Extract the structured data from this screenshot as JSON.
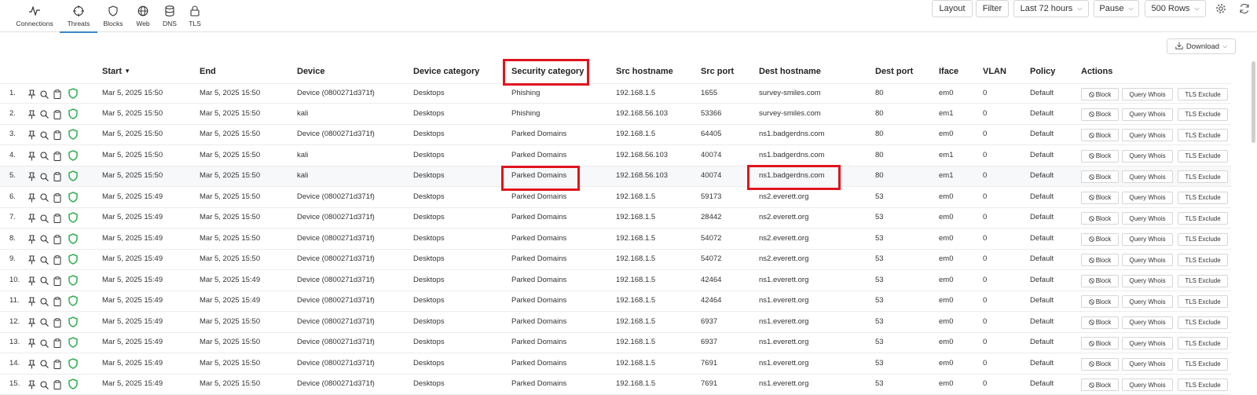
{
  "nav": [
    {
      "label": "Connections",
      "icon": "activity-icon"
    },
    {
      "label": "Threats",
      "icon": "crosshair-icon"
    },
    {
      "label": "Blocks",
      "icon": "shield-icon"
    },
    {
      "label": "Web",
      "icon": "globe-icon"
    },
    {
      "label": "DNS",
      "icon": "database-icon"
    },
    {
      "label": "TLS",
      "icon": "lock-icon"
    }
  ],
  "toolbar": {
    "layout": "Layout",
    "filter": "Filter",
    "timerange": "Last 72 hours",
    "pause": "Pause",
    "rows": "500 Rows",
    "download": "Download"
  },
  "columns": {
    "start": "Start",
    "end": "End",
    "device": "Device",
    "device_category": "Device category",
    "security_category": "Security category",
    "src_hostname": "Src hostname",
    "src_port": "Src port",
    "dest_hostname": "Dest hostname",
    "dest_port": "Dest port",
    "iface": "Iface",
    "vlan": "VLAN",
    "policy": "Policy",
    "actions": "Actions"
  },
  "actions": {
    "block": "Block",
    "whois": "Query Whois",
    "tls": "TLS Exclude"
  },
  "rows": [
    {
      "n": "1.",
      "start": "Mar 5, 2025 15:50",
      "end": "Mar 5, 2025 15:50",
      "device": "Device (0800271d371f)",
      "devcat": "Desktops",
      "seccat": "Phishing",
      "src": "192.168.1.5",
      "sport": "1655",
      "dest": "survey-smiles.com",
      "dport": "80",
      "iface": "em0",
      "vlan": "0",
      "policy": "Default"
    },
    {
      "n": "2.",
      "start": "Mar 5, 2025 15:50",
      "end": "Mar 5, 2025 15:50",
      "device": "kali",
      "devcat": "Desktops",
      "seccat": "Phishing",
      "src": "192.168.56.103",
      "sport": "53366",
      "dest": "survey-smiles.com",
      "dport": "80",
      "iface": "em1",
      "vlan": "0",
      "policy": "Default"
    },
    {
      "n": "3.",
      "start": "Mar 5, 2025 15:50",
      "end": "Mar 5, 2025 15:50",
      "device": "Device (0800271d371f)",
      "devcat": "Desktops",
      "seccat": "Parked Domains",
      "src": "192.168.1.5",
      "sport": "64405",
      "dest": "ns1.badgerdns.com",
      "dport": "80",
      "iface": "em0",
      "vlan": "0",
      "policy": "Default"
    },
    {
      "n": "4.",
      "start": "Mar 5, 2025 15:50",
      "end": "Mar 5, 2025 15:50",
      "device": "kali",
      "devcat": "Desktops",
      "seccat": "Parked Domains",
      "src": "192.168.56.103",
      "sport": "40074",
      "dest": "ns1.badgerdns.com",
      "dport": "80",
      "iface": "em1",
      "vlan": "0",
      "policy": "Default"
    },
    {
      "n": "5.",
      "start": "Mar 5, 2025 15:50",
      "end": "Mar 5, 2025 15:50",
      "device": "kali",
      "devcat": "Desktops",
      "seccat": "Parked Domains",
      "src": "192.168.56.103",
      "sport": "40074",
      "dest": "ns1.badgerdns.com",
      "dport": "80",
      "iface": "em1",
      "vlan": "0",
      "policy": "Default"
    },
    {
      "n": "6.",
      "start": "Mar 5, 2025 15:49",
      "end": "Mar 5, 2025 15:50",
      "device": "Device (0800271d371f)",
      "devcat": "Desktops",
      "seccat": "Parked Domains",
      "src": "192.168.1.5",
      "sport": "59173",
      "dest": "ns2.everett.org",
      "dport": "53",
      "iface": "em0",
      "vlan": "0",
      "policy": "Default"
    },
    {
      "n": "7.",
      "start": "Mar 5, 2025 15:49",
      "end": "Mar 5, 2025 15:50",
      "device": "Device (0800271d371f)",
      "devcat": "Desktops",
      "seccat": "Parked Domains",
      "src": "192.168.1.5",
      "sport": "28442",
      "dest": "ns2.everett.org",
      "dport": "53",
      "iface": "em0",
      "vlan": "0",
      "policy": "Default"
    },
    {
      "n": "8.",
      "start": "Mar 5, 2025 15:49",
      "end": "Mar 5, 2025 15:50",
      "device": "Device (0800271d371f)",
      "devcat": "Desktops",
      "seccat": "Parked Domains",
      "src": "192.168.1.5",
      "sport": "54072",
      "dest": "ns2.everett.org",
      "dport": "53",
      "iface": "em0",
      "vlan": "0",
      "policy": "Default"
    },
    {
      "n": "9.",
      "start": "Mar 5, 2025 15:49",
      "end": "Mar 5, 2025 15:50",
      "device": "Device (0800271d371f)",
      "devcat": "Desktops",
      "seccat": "Parked Domains",
      "src": "192.168.1.5",
      "sport": "54072",
      "dest": "ns2.everett.org",
      "dport": "53",
      "iface": "em0",
      "vlan": "0",
      "policy": "Default"
    },
    {
      "n": "10.",
      "start": "Mar 5, 2025 15:49",
      "end": "Mar 5, 2025 15:49",
      "device": "Device (0800271d371f)",
      "devcat": "Desktops",
      "seccat": "Parked Domains",
      "src": "192.168.1.5",
      "sport": "42464",
      "dest": "ns1.everett.org",
      "dport": "53",
      "iface": "em0",
      "vlan": "0",
      "policy": "Default"
    },
    {
      "n": "11.",
      "start": "Mar 5, 2025 15:49",
      "end": "Mar 5, 2025 15:49",
      "device": "Device (0800271d371f)",
      "devcat": "Desktops",
      "seccat": "Parked Domains",
      "src": "192.168.1.5",
      "sport": "42464",
      "dest": "ns1.everett.org",
      "dport": "53",
      "iface": "em0",
      "vlan": "0",
      "policy": "Default"
    },
    {
      "n": "12.",
      "start": "Mar 5, 2025 15:49",
      "end": "Mar 5, 2025 15:50",
      "device": "Device (0800271d371f)",
      "devcat": "Desktops",
      "seccat": "Parked Domains",
      "src": "192.168.1.5",
      "sport": "6937",
      "dest": "ns1.everett.org",
      "dport": "53",
      "iface": "em0",
      "vlan": "0",
      "policy": "Default"
    },
    {
      "n": "13.",
      "start": "Mar 5, 2025 15:49",
      "end": "Mar 5, 2025 15:50",
      "device": "Device (0800271d371f)",
      "devcat": "Desktops",
      "seccat": "Parked Domains",
      "src": "192.168.1.5",
      "sport": "6937",
      "dest": "ns1.everett.org",
      "dport": "53",
      "iface": "em0",
      "vlan": "0",
      "policy": "Default"
    },
    {
      "n": "14.",
      "start": "Mar 5, 2025 15:49",
      "end": "Mar 5, 2025 15:50",
      "device": "Device (0800271d371f)",
      "devcat": "Desktops",
      "seccat": "Parked Domains",
      "src": "192.168.1.5",
      "sport": "7691",
      "dest": "ns1.everett.org",
      "dport": "53",
      "iface": "em0",
      "vlan": "0",
      "policy": "Default"
    },
    {
      "n": "15.",
      "start": "Mar 5, 2025 15:49",
      "end": "Mar 5, 2025 15:50",
      "device": "Device (0800271d371f)",
      "devcat": "Desktops",
      "seccat": "Parked Domains",
      "src": "192.168.1.5",
      "sport": "7691",
      "dest": "ns1.everett.org",
      "dport": "53",
      "iface": "em0",
      "vlan": "0",
      "policy": "Default"
    }
  ],
  "colors": {
    "accent": "#3a86c8",
    "highlight_box": "#e0141e",
    "shield": "#2fae4f"
  }
}
